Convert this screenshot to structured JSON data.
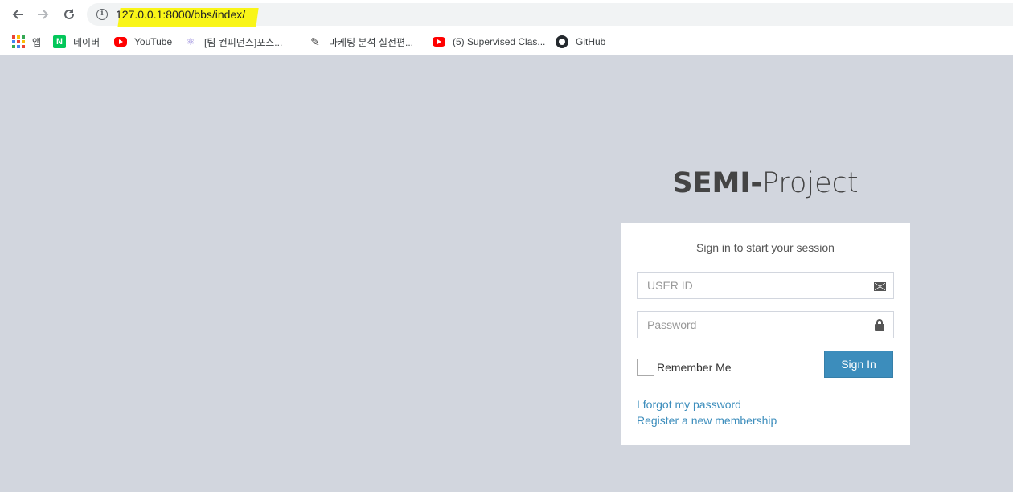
{
  "browser": {
    "url": "127.0.0.1:8000/bbs/index/",
    "highlight_color": "#f9f500",
    "nav": {
      "back_icon": "arrow-left-icon",
      "forward_icon": "arrow-right-icon",
      "reload_icon": "reload-icon",
      "info_icon": "info-icon"
    },
    "bookmarks": [
      {
        "label": "앱",
        "icon": "apps-icon"
      },
      {
        "label": "네이버",
        "icon": "naver-icon"
      },
      {
        "label": "YouTube",
        "icon": "youtube-icon"
      },
      {
        "label": "[팀 컨피던스]포스...",
        "icon": "molecule-icon"
      },
      {
        "label": "마케팅 분석 실전편...",
        "icon": "pen-icon"
      },
      {
        "label": "(5) Supervised Clas...",
        "icon": "youtube-icon"
      },
      {
        "label": "GitHub",
        "icon": "github-icon"
      }
    ]
  },
  "login": {
    "logo_bold": "SEMI-",
    "logo_light": "Project",
    "message": "Sign in to start your session",
    "userid_placeholder": "USER ID",
    "password_placeholder": "Password",
    "remember_label": "Remember Me",
    "signin_label": "Sign In",
    "forgot_link": "I forgot my password",
    "register_link": "Register a new membership",
    "accent_color": "#3c8dbc",
    "page_bg": "#d2d6de"
  }
}
